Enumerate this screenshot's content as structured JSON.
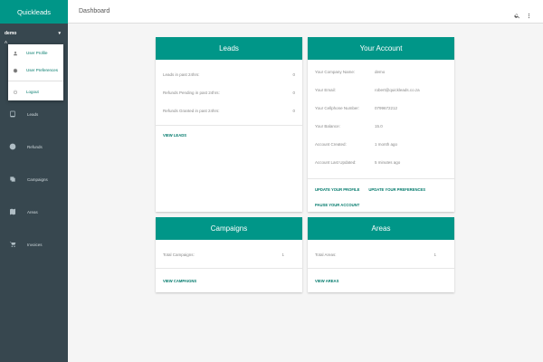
{
  "sidebar": {
    "brand": "Quickleads",
    "user": "demo",
    "user_sub": "A",
    "caret": "▾",
    "nav": [
      {
        "label": "Leads",
        "icon": "tablet-icon"
      },
      {
        "label": "Refunds",
        "icon": "refund-icon"
      },
      {
        "label": "Campaigns",
        "icon": "campaign-icon"
      },
      {
        "label": "Areas",
        "icon": "map-icon"
      },
      {
        "label": "Invoices",
        "icon": "cart-icon"
      }
    ]
  },
  "dropdown": {
    "items": [
      {
        "label": "User Profile",
        "icon": "person-icon"
      },
      {
        "label": "User Preferences",
        "icon": "gear-icon"
      },
      {
        "label": "Logout",
        "icon": "power-icon"
      }
    ]
  },
  "topbar": {
    "title": "Dashboard",
    "icons": [
      "search-icon",
      "more-vert-icon"
    ]
  },
  "cards": {
    "leads": {
      "title": "Leads",
      "rows": [
        {
          "label": "Leads in past 24hrs:",
          "value": "0"
        },
        {
          "label": "Refunds Pending in past 24hrs:",
          "value": "0"
        },
        {
          "label": "Refunds Granted in past 24hrs:",
          "value": "0"
        }
      ],
      "link": "VIEW LEADS"
    },
    "account": {
      "title": "Your Account",
      "rows": [
        {
          "label": "Your Company Name:",
          "value": "demo"
        },
        {
          "label": "Your Email:",
          "value": "robert@quickleads.co.za"
        },
        {
          "label": "Your Cellphone Number:",
          "value": "0799672212"
        },
        {
          "label": "Your Balance:",
          "value": "15.0"
        },
        {
          "label": "Account Created:",
          "value": "1 month ago"
        },
        {
          "label": "Account Last Updated:",
          "value": "5 minutes ago"
        }
      ],
      "links": [
        "UPDATE YOUR PROFILE",
        "UPDATE YOUR PREFERENCES",
        "PAUSE YOUR ACCOUNT"
      ]
    },
    "campaigns": {
      "title": "Campaigns",
      "rows": [
        {
          "label": "Total Campaigns:",
          "value": "1"
        }
      ],
      "link": "VIEW CAMPAIGNS"
    },
    "areas": {
      "title": "Areas",
      "rows": [
        {
          "label": "Total Areas:",
          "value": "1"
        }
      ],
      "link": "VIEW AREAS"
    }
  },
  "colors": {
    "accent": "#009688",
    "sidebar": "#37474f",
    "link": "#00796b"
  }
}
